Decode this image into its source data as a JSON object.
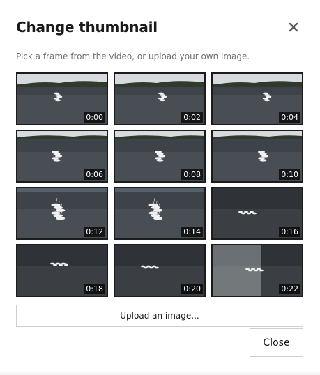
{
  "dialog": {
    "title": "Change thumbnail",
    "subtitle": "Pick a frame from the video, or upload your own image.",
    "close_icon": "close-icon"
  },
  "frames": [
    {
      "time": "0:00",
      "scene": "far"
    },
    {
      "time": "0:02",
      "scene": "far"
    },
    {
      "time": "0:04",
      "scene": "far"
    },
    {
      "time": "0:06",
      "scene": "near"
    },
    {
      "time": "0:08",
      "scene": "near"
    },
    {
      "time": "0:10",
      "scene": "near"
    },
    {
      "time": "0:12",
      "scene": "close"
    },
    {
      "time": "0:14",
      "scene": "close"
    },
    {
      "time": "0:16",
      "scene": "overhead"
    },
    {
      "time": "0:18",
      "scene": "overhead"
    },
    {
      "time": "0:20",
      "scene": "overhead"
    },
    {
      "time": "0:22",
      "scene": "overhead"
    }
  ],
  "actions": {
    "upload_label": "Upload an image...",
    "close_label": "Close"
  },
  "colors": {
    "water": "#3d4349",
    "sky": "#d7dbdf",
    "shore": "#2f3a2c",
    "boat": "#f2f2f2"
  }
}
